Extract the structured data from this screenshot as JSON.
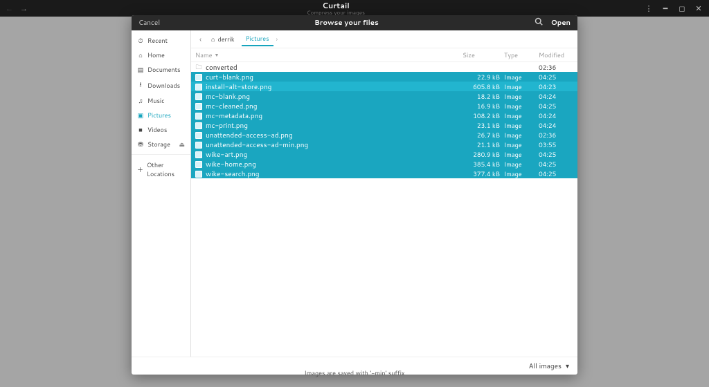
{
  "app": {
    "title": "Curtail",
    "subtitle": "Compress your images"
  },
  "statusbar": {
    "text": "Images are saved with '-min' suffix"
  },
  "dialog": {
    "cancel": "Cancel",
    "title": "Browse your files",
    "open": "Open",
    "filter": "All images"
  },
  "sidebar": {
    "items": [
      {
        "icon": "⏱",
        "label": "Recent"
      },
      {
        "icon": "⌂",
        "label": "Home"
      },
      {
        "icon": "▤",
        "label": "Documents"
      },
      {
        "icon": "⭳",
        "label": "Downloads"
      },
      {
        "icon": "♫",
        "label": "Music"
      },
      {
        "icon": "▣",
        "label": "Pictures"
      },
      {
        "icon": "■",
        "label": "Videos"
      },
      {
        "icon": "⛃",
        "label": "Storage",
        "eject": true
      }
    ],
    "other": "Other Locations"
  },
  "breadcrumb": {
    "home_user": "derrik",
    "current": "Pictures"
  },
  "columns": {
    "name": "Name",
    "size": "Size",
    "type": "Type",
    "modified": "Modified"
  },
  "files": [
    {
      "kind": "folder",
      "name": "converted",
      "size": "",
      "type": "",
      "modified": "02:36",
      "selected": false
    },
    {
      "kind": "image",
      "name": "curt-blank.png",
      "size": "22.9 kB",
      "type": "Image",
      "modified": "04:25",
      "selected": true
    },
    {
      "kind": "image",
      "name": "install-alt-store.png",
      "size": "605.8 kB",
      "type": "Image",
      "modified": "04:23",
      "selected": true,
      "tint": true
    },
    {
      "kind": "image",
      "name": "mc-blank.png",
      "size": "18.2 kB",
      "type": "Image",
      "modified": "04:24",
      "selected": true
    },
    {
      "kind": "image",
      "name": "mc-cleaned.png",
      "size": "16.9 kB",
      "type": "Image",
      "modified": "04:25",
      "selected": true
    },
    {
      "kind": "image",
      "name": "mc-metadata.png",
      "size": "108.2 kB",
      "type": "Image",
      "modified": "04:24",
      "selected": true
    },
    {
      "kind": "image",
      "name": "mc-print.png",
      "size": "23.1 kB",
      "type": "Image",
      "modified": "04:24",
      "selected": true
    },
    {
      "kind": "image",
      "name": "unattended-access-ad.png",
      "size": "26.7 kB",
      "type": "Image",
      "modified": "02:36",
      "selected": true
    },
    {
      "kind": "image",
      "name": "unattended-access-ad-min.png",
      "size": "21.1 kB",
      "type": "Image",
      "modified": "03:55",
      "selected": true
    },
    {
      "kind": "image",
      "name": "wike-art.png",
      "size": "280.9 kB",
      "type": "Image",
      "modified": "04:25",
      "selected": true
    },
    {
      "kind": "image",
      "name": "wike-home.png",
      "size": "385.4 kB",
      "type": "Image",
      "modified": "04:25",
      "selected": true
    },
    {
      "kind": "image",
      "name": "wike-search.png",
      "size": "377.4 kB",
      "type": "Image",
      "modified": "04:25",
      "selected": true
    }
  ]
}
